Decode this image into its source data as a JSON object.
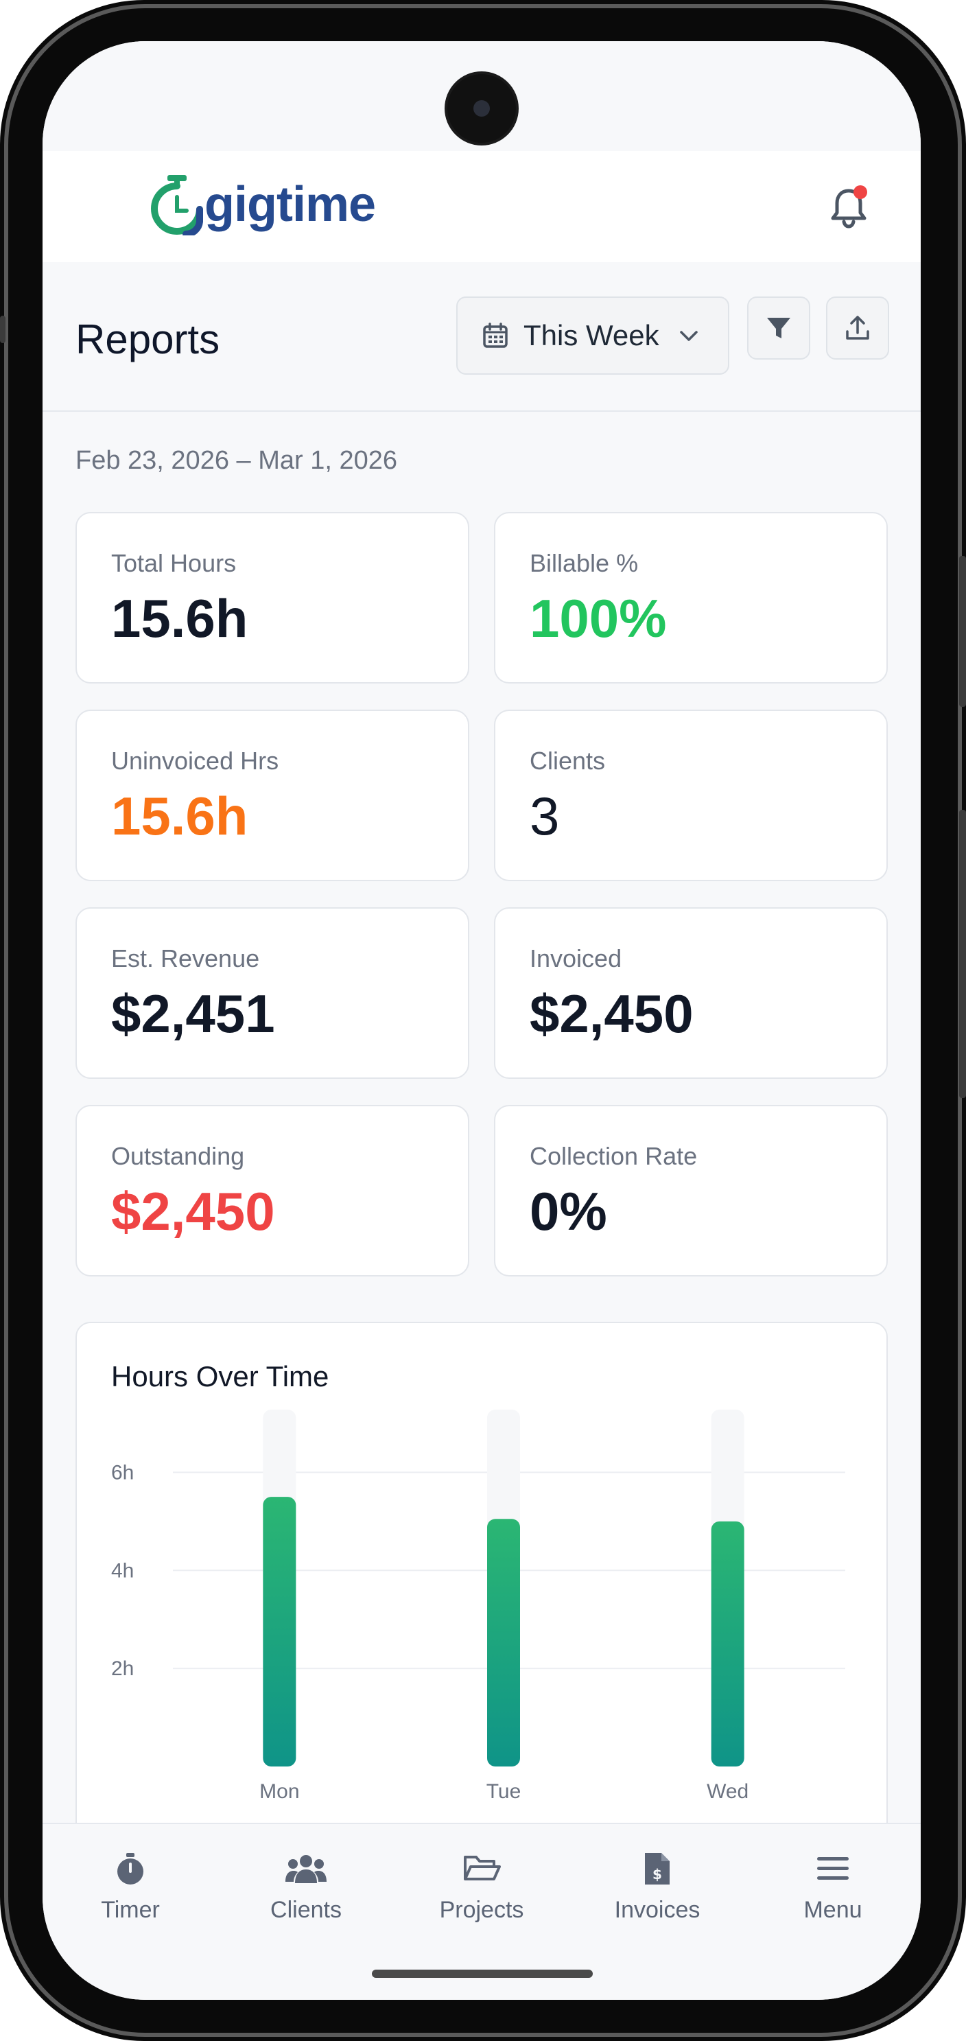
{
  "app": {
    "name": "gigtime"
  },
  "header": {
    "title": "Reports",
    "period_label": "This Week"
  },
  "date_range": "Feb 23, 2026 – Mar 1, 2026",
  "stats": [
    {
      "label": "Total Hours",
      "value": "15.6h",
      "color": "#111827"
    },
    {
      "label": "Billable %",
      "value": "100%",
      "color": "#22c55e"
    },
    {
      "label": "Uninvoiced Hrs",
      "value": "15.6h",
      "color": "#f97316"
    },
    {
      "label": "Clients",
      "value": "3",
      "color": "#111827"
    },
    {
      "label": "Est. Revenue",
      "value": "$2,451",
      "color": "#111827"
    },
    {
      "label": "Invoiced",
      "value": "$2,450",
      "color": "#111827"
    },
    {
      "label": "Outstanding",
      "value": "$2,450",
      "color": "#ef4444"
    },
    {
      "label": "Collection Rate",
      "value": "0%",
      "color": "#111827"
    }
  ],
  "chart": {
    "title": "Hours Over Time"
  },
  "chart_data": {
    "type": "bar",
    "title": "Hours Over Time",
    "categories": [
      "Mon",
      "Tue",
      "Wed"
    ],
    "values": [
      5.5,
      5.05,
      5.0
    ],
    "ylim": [
      0,
      7
    ],
    "yticks": [
      2,
      4,
      6
    ],
    "ytick_labels": [
      "2h",
      "4h",
      "6h"
    ],
    "grid": true,
    "bar_color_top": "#2bb673",
    "bar_color_bottom": "#0f9488"
  },
  "nav": [
    {
      "label": "Timer",
      "icon": "stopwatch-icon"
    },
    {
      "label": "Clients",
      "icon": "users-icon"
    },
    {
      "label": "Projects",
      "icon": "folder-open-icon"
    },
    {
      "label": "Invoices",
      "icon": "invoice-icon"
    },
    {
      "label": "Menu",
      "icon": "menu-icon"
    }
  ],
  "colors": {
    "brand_green": "#22a06b",
    "brand_blue": "#264a8f",
    "notification_dot": "#ef4444"
  }
}
